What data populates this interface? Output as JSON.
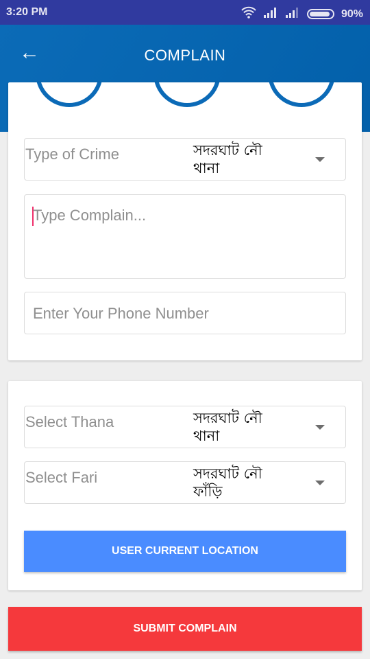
{
  "status": {
    "time": "3:20 PM",
    "battery": "90%",
    "battery_level": 0.9
  },
  "header": {
    "title": "COMPLAIN"
  },
  "form": {
    "crime": {
      "label": "Type of Crime",
      "value": "সদরঘাট নৌ থানা"
    },
    "complain": {
      "placeholder": "Type Complain..."
    },
    "phone": {
      "placeholder": "Enter Your Phone Number"
    }
  },
  "location": {
    "thana": {
      "label": "Select Thana",
      "value": "সদরঘাট নৌ থানা"
    },
    "fari": {
      "label": "Select Fari",
      "value": "সদরঘাট নৌ ফাঁড়ি"
    },
    "button": "USER CURRENT LOCATION"
  },
  "submit": "SUBMIT COMPLAIN",
  "colors": {
    "primary": "#0563ad",
    "status": "#303a9f",
    "location_btn": "#4a8cff",
    "submit_btn": "#f5393c"
  }
}
